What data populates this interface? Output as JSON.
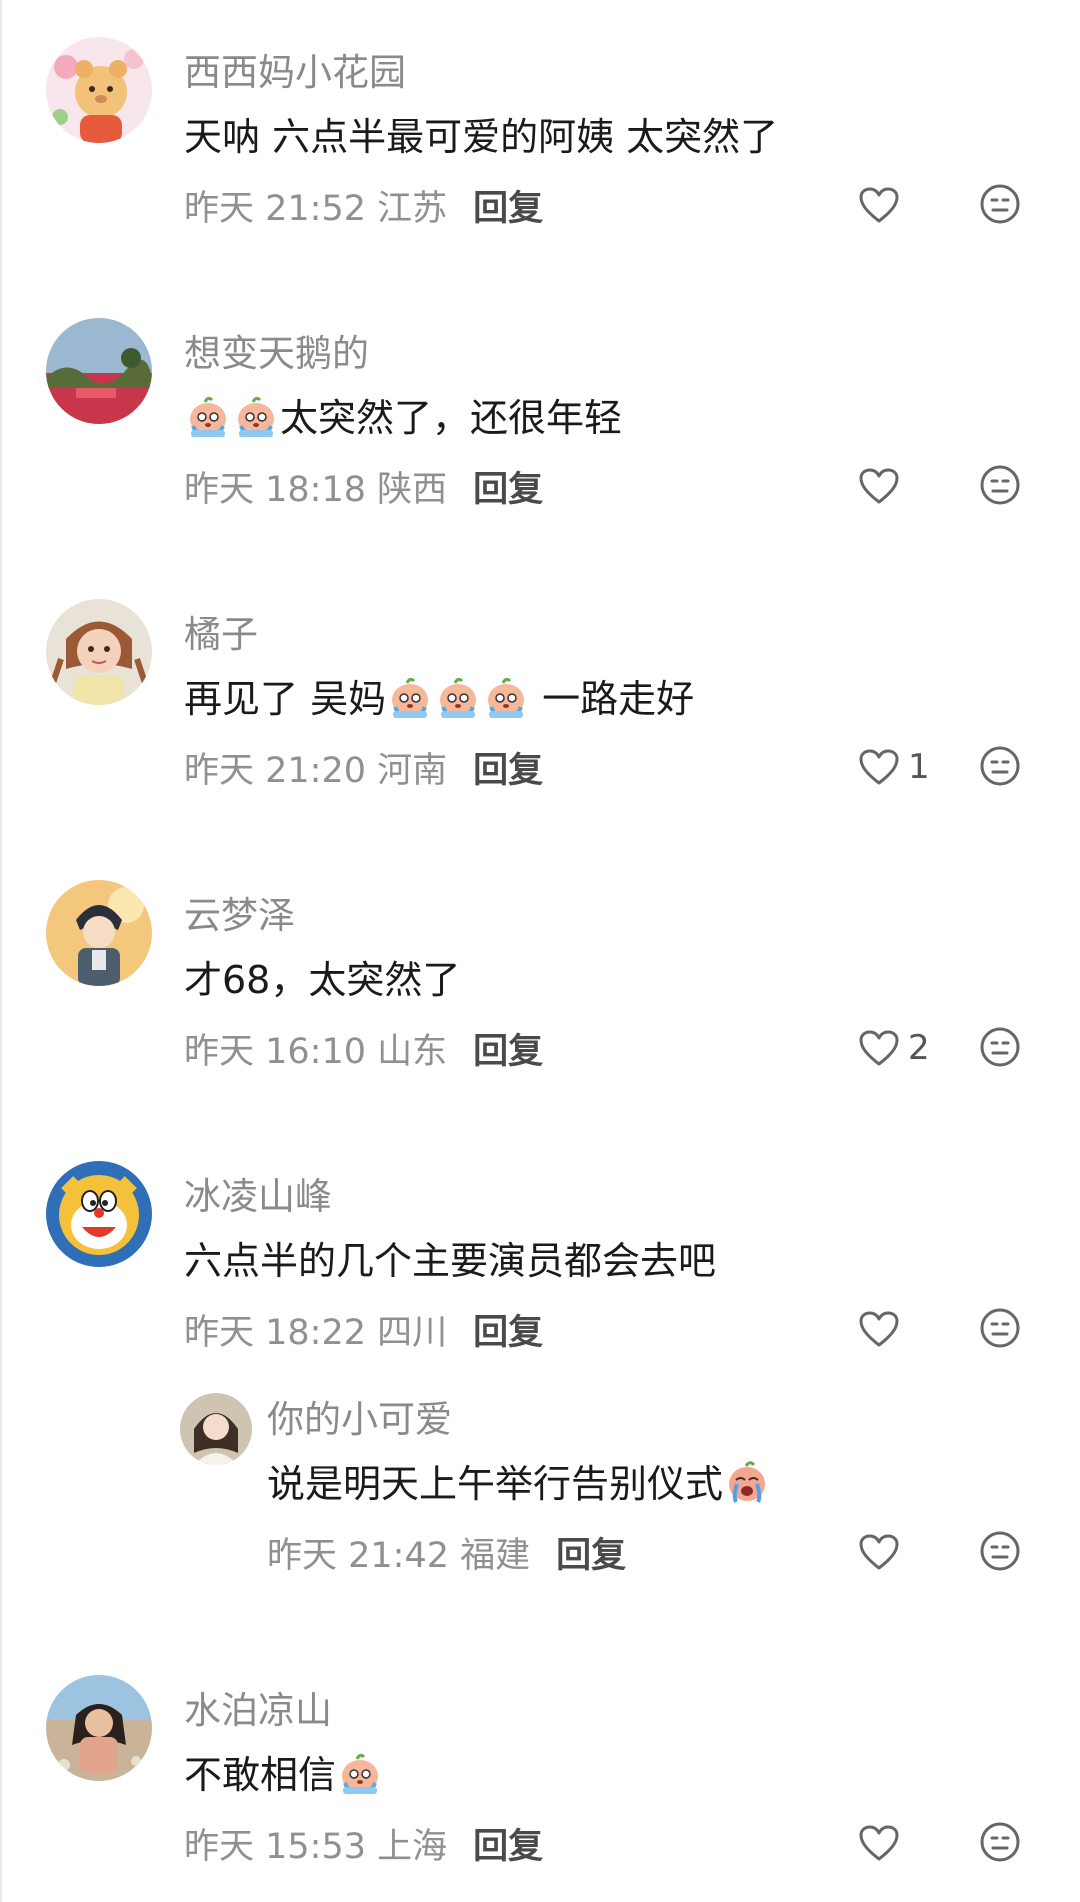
{
  "comments": [
    {
      "username": "西西妈小花园",
      "text": "天呐 六点半最可爱的阿姨 太突然了",
      "time": "昨天 21:52",
      "location": "江苏",
      "reply_label": "回复",
      "likes": "",
      "avatar": "flower-bear-avatar"
    },
    {
      "username": "想变天鹅的",
      "text_before": "",
      "text_after": "太突然了，还很年轻",
      "emoji": "crying-emoji",
      "time": "昨天 18:18",
      "location": "陕西",
      "reply_label": "回复",
      "likes": "",
      "avatar": "scenery-avatar"
    },
    {
      "username": "橘子",
      "text_before": "再见了 吴妈",
      "text_after": " 一路走好",
      "emoji": "crying-emoji",
      "time": "昨天 21:20",
      "location": "河南",
      "reply_label": "回复",
      "likes": "1",
      "avatar": "girl-avatar"
    },
    {
      "username": "云梦泽",
      "text": "才68，太突然了",
      "time": "昨天 16:10",
      "location": "山东",
      "reply_label": "回复",
      "likes": "2",
      "avatar": "anime-boy-avatar"
    },
    {
      "username": "冰凌山峰",
      "text": "六点半的几个主要演员都会去吧",
      "time": "昨天 18:22",
      "location": "四川",
      "reply_label": "回复",
      "likes": "",
      "avatar": "doraemon-avatar",
      "reply": {
        "username": "你的小可爱",
        "text": "说是明天上午举行告别仪式",
        "emoji": "crying-emoji",
        "time": "昨天 21:42",
        "location": "福建",
        "reply_label": "回复",
        "likes": "",
        "avatar": "bride-avatar"
      }
    },
    {
      "username": "水泊凉山",
      "text": "不敢相信",
      "emoji": "crying-emoji",
      "time": "昨天 15:53",
      "location": "上海",
      "reply_label": "回复",
      "likes": "",
      "avatar": "beach-woman-avatar"
    }
  ],
  "colors": {
    "username": "#8a8a8a",
    "text": "#1a1a1a",
    "meta": "#909090",
    "icon": "#666666"
  },
  "icons": {
    "like": "heart-outline-icon",
    "dislike": "unamused-face-icon"
  }
}
